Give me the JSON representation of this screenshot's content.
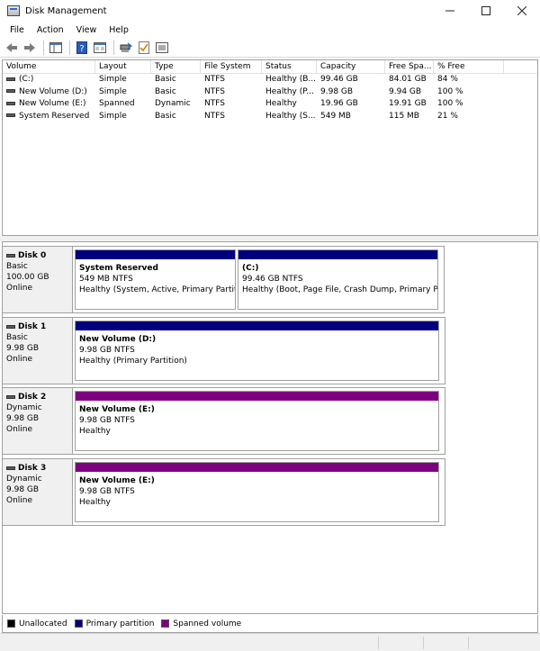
{
  "window": {
    "title": "Disk Management"
  },
  "menu": [
    "File",
    "Action",
    "View",
    "Help"
  ],
  "toolbar_icons": [
    "back-arrow-icon",
    "forward-arrow-icon",
    "show-hide-console-tree-icon",
    "help-icon",
    "properties-icon",
    "connect-disk-icon",
    "checklist-icon",
    "settings-panel-icon"
  ],
  "volume_table": {
    "columns": [
      "Volume",
      "Layout",
      "Type",
      "File System",
      "Status",
      "Capacity",
      "Free Spa...",
      "% Free"
    ],
    "rows": [
      [
        "(C:)",
        "Simple",
        "Basic",
        "NTFS",
        "Healthy (B...",
        "99.46 GB",
        "84.01 GB",
        "84 %"
      ],
      [
        "New Volume (D:)",
        "Simple",
        "Basic",
        "NTFS",
        "Healthy (P...",
        "9.98 GB",
        "9.94 GB",
        "100 %"
      ],
      [
        "New Volume (E:)",
        "Spanned",
        "Dynamic",
        "NTFS",
        "Healthy",
        "19.96 GB",
        "19.91 GB",
        "100 %"
      ],
      [
        "System Reserved",
        "Simple",
        "Basic",
        "NTFS",
        "Healthy (S...",
        "549 MB",
        "115 MB",
        "21 %"
      ]
    ]
  },
  "colors": {
    "primary": "#00007f",
    "spanned": "#7f007f",
    "unallocated": "#000000"
  },
  "disks": [
    {
      "name": "Disk 0",
      "type": "Basic",
      "size": "100.00 GB",
      "status": "Online",
      "partitions": [
        {
          "name": "System Reserved",
          "size": "549 MB NTFS",
          "status": "Healthy (System, Active, Primary Partitic",
          "kind": "primary"
        },
        {
          "name": "(C:)",
          "size": "99.46 GB NTFS",
          "status": "Healthy (Boot, Page File, Crash Dump, Primary Partition)",
          "kind": "primary"
        }
      ]
    },
    {
      "name": "Disk 1",
      "type": "Basic",
      "size": "9.98 GB",
      "status": "Online",
      "partitions": [
        {
          "name": "New Volume  (D:)",
          "size": "9.98 GB NTFS",
          "status": "Healthy (Primary Partition)",
          "kind": "primary"
        }
      ]
    },
    {
      "name": "Disk 2",
      "type": "Dynamic",
      "size": "9.98 GB",
      "status": "Online",
      "partitions": [
        {
          "name": "New Volume  (E:)",
          "size": "9.98 GB NTFS",
          "status": "Healthy",
          "kind": "spanned"
        }
      ]
    },
    {
      "name": "Disk 3",
      "type": "Dynamic",
      "size": "9.98 GB",
      "status": "Online",
      "partitions": [
        {
          "name": "New Volume  (E:)",
          "size": "9.98 GB NTFS",
          "status": "Healthy",
          "kind": "spanned"
        }
      ]
    }
  ],
  "legend": [
    {
      "label": "Unallocated",
      "color": "#000000"
    },
    {
      "label": "Primary partition",
      "color": "#00007f"
    },
    {
      "label": "Spanned volume",
      "color": "#7f007f"
    }
  ]
}
